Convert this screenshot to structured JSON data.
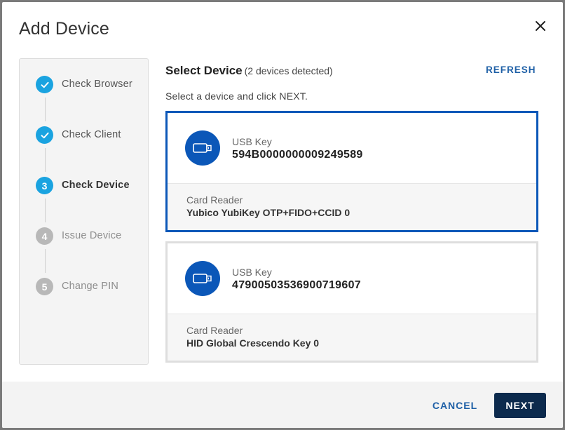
{
  "dialog": {
    "title": "Add Device",
    "close_icon": "close-icon"
  },
  "stepper": {
    "steps": [
      {
        "number": "1",
        "label": "Check Browser",
        "state": "done",
        "icon": "check-icon"
      },
      {
        "number": "2",
        "label": "Check Client",
        "state": "done",
        "icon": "check-icon"
      },
      {
        "number": "3",
        "label": "Check Device",
        "state": "active"
      },
      {
        "number": "4",
        "label": "Issue Device",
        "state": "todo"
      },
      {
        "number": "5",
        "label": "Change PIN",
        "state": "todo"
      }
    ]
  },
  "main": {
    "title": "Select Device",
    "count": "(2 devices detected)",
    "refresh_label": "REFRESH",
    "instruction": "Select a device and click NEXT.",
    "devices": [
      {
        "type": "USB Key",
        "serial": "594B0000000009249589",
        "reader_label": "Card Reader",
        "reader_name": "Yubico YubiKey OTP+FIDO+CCID 0",
        "selected": true,
        "icon": "usb-key-icon"
      },
      {
        "type": "USB Key",
        "serial": "47900503536900719607",
        "reader_label": "Card Reader",
        "reader_name": "HID Global Crescendo Key 0",
        "selected": false,
        "icon": "usb-key-icon"
      }
    ]
  },
  "footer": {
    "cancel_label": "CANCEL",
    "next_label": "NEXT"
  },
  "colors": {
    "accent": "#1aa3e0",
    "primary": "#0b57b8",
    "button_dark": "#0c2a4d",
    "link": "#1d5fa6",
    "step_todo": "#b8b8b8"
  }
}
